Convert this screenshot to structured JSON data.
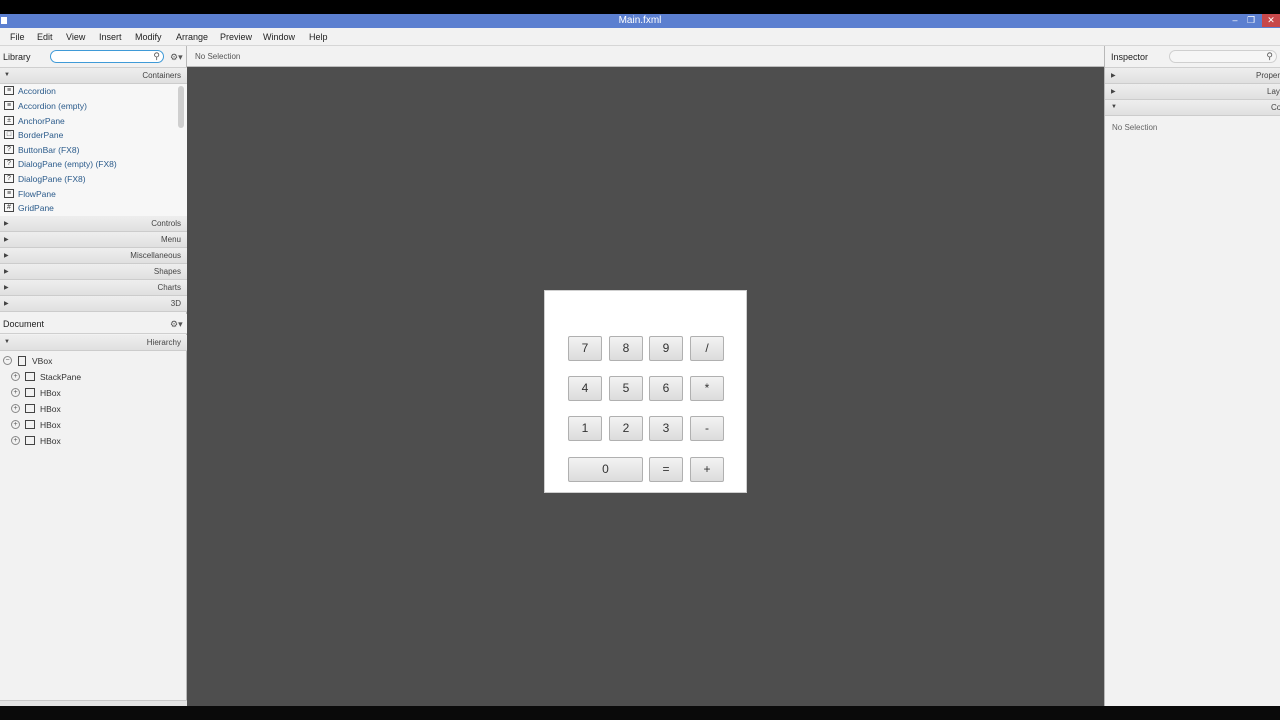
{
  "window": {
    "title": "Main.fxml"
  },
  "menu": [
    "File",
    "Edit",
    "View",
    "Insert",
    "Modify",
    "Arrange",
    "Preview",
    "Window",
    "Help"
  ],
  "library": {
    "label": "Library",
    "search_placeholder": "",
    "sections": {
      "containers": "Containers",
      "controls": "Controls",
      "menu": "Menu",
      "miscellaneous": "Miscellaneous",
      "shapes": "Shapes",
      "charts": "Charts",
      "three_d": "3D"
    },
    "items": [
      "Accordion",
      "Accordion  (empty)",
      "AnchorPane",
      "BorderPane",
      "ButtonBar  (FX8)",
      "DialogPane (empty)  (FX8)",
      "DialogPane  (FX8)",
      "FlowPane",
      "GridPane"
    ]
  },
  "document": {
    "label": "Document",
    "hierarchy_label": "Hierarchy",
    "tree": [
      "VBox",
      "StackPane",
      "HBox",
      "HBox",
      "HBox",
      "HBox"
    ]
  },
  "canvas": {
    "selection_text": "No Selection",
    "buttons": {
      "row1": [
        "7",
        "8",
        "9",
        "/"
      ],
      "row2": [
        "4",
        "5",
        "6",
        "*"
      ],
      "row3": [
        "1",
        "2",
        "3",
        "-"
      ],
      "row4": [
        "0",
        "=",
        "+"
      ]
    }
  },
  "inspector": {
    "label": "Inspector",
    "sections": [
      "Properti",
      "Layo",
      "Co"
    ],
    "selection_text": "No Selection"
  },
  "colors": {
    "titlebar": "#5b7fd0",
    "close": "#c7484a",
    "canvas_bg": "#4e4e4e",
    "link_text": "#2b5b8b"
  }
}
